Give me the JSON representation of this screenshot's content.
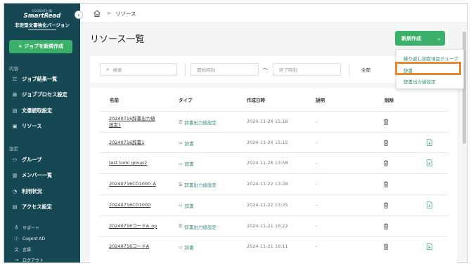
{
  "sidebar": {
    "brand_small": "COGENT社製",
    "brand_name": "SmartRead",
    "brand_sub": "非定型文書強化バージョン",
    "new_job": "+ ジョブを新規作成",
    "section_content": "内容",
    "items_content": [
      {
        "label": "ジョブ結果一覧",
        "icon": "list-icon"
      },
      {
        "label": "ジョブプロセス設定",
        "icon": "process-icon"
      },
      {
        "label": "文書読取設定",
        "icon": "document-icon"
      },
      {
        "label": "リソース",
        "icon": "resource-icon"
      }
    ],
    "section_settings": "設定",
    "items_settings": [
      {
        "label": "グループ",
        "icon": "group-icon"
      },
      {
        "label": "メンバー一覧",
        "icon": "members-icon"
      },
      {
        "label": "利用状況",
        "icon": "usage-icon"
      },
      {
        "label": "アクセス設定",
        "icon": "access-icon"
      }
    ],
    "footer": [
      {
        "label": "サポート",
        "icon": "support-icon"
      },
      {
        "label": "Cogent AD",
        "icon": "info-icon"
      },
      {
        "label": "言語",
        "icon": "language-icon"
      },
      {
        "label": "ログアウト",
        "icon": "logout-icon"
      }
    ]
  },
  "breadcrumb": {
    "separator": ">",
    "current": "リソース"
  },
  "page_title": "リソース一覧",
  "create_button": "新規作成",
  "dropdown": {
    "items": [
      "繰り返し読取項目グループ",
      "辞書",
      "辞書出力値設定"
    ],
    "highlighted": "辞書"
  },
  "filters": {
    "search_placeholder": "検索",
    "start_placeholder": "開始時刻",
    "end_placeholder": "終了時刻",
    "tilde": "〜",
    "type_value": "全部"
  },
  "table": {
    "headers": {
      "name": "名前",
      "type": "タイプ",
      "created": "作成日時",
      "description": "説明",
      "delete": "削除"
    },
    "rows": [
      {
        "name1": "20240716辞書出力値",
        "name2": "設定1",
        "type": "辞書出力値設定",
        "created": "2024-11-26 15:16",
        "desc": "-",
        "download": false
      },
      {
        "name1": "20240716辞書1",
        "name2": "",
        "type": "辞書",
        "created": "2024-11-26 15:15",
        "desc": "-",
        "download": true
      },
      {
        "name1": "test tomi group2",
        "name2": "",
        "type": "辞書",
        "created": "2024-11-26 13:58",
        "desc": "-",
        "download": true
      },
      {
        "name1": "20240716CD1000_A",
        "name2": "",
        "type": "辞書出力値設定",
        "created": "2024-11-22 13:28",
        "desc": "-",
        "download": false
      },
      {
        "name1": "20240716CD1000",
        "name2": "",
        "type": "辞書",
        "created": "2024-11-22 13:25",
        "desc": "-",
        "download": true
      },
      {
        "name1": "20240716コードA_op",
        "name2": "",
        "type": "辞書出力値設定",
        "created": "2024-11-21 16:22",
        "desc": "-",
        "download": false
      },
      {
        "name1": "20240716コードA",
        "name2": "",
        "type": "辞書",
        "created": "2024-11-21 16:11",
        "desc": "-",
        "download": true
      }
    ]
  },
  "colors": {
    "sidebar": "#164854",
    "accent": "#3bb06a",
    "highlight": "#e8872c"
  }
}
